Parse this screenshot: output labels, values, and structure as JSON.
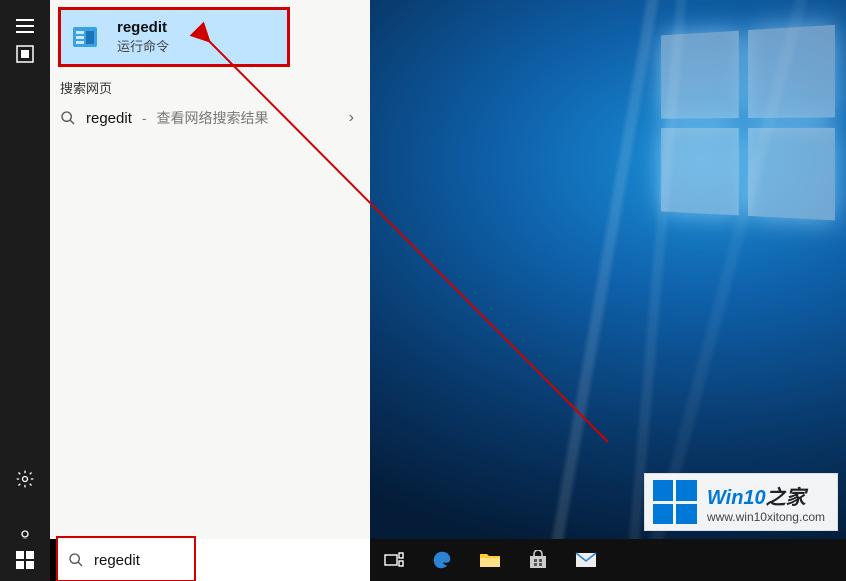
{
  "search": {
    "query": "regedit",
    "placeholder": ""
  },
  "bestMatch": {
    "title": "regedit",
    "subtitle": "运行命令",
    "iconName": "regedit-icon"
  },
  "sections": {
    "webHeader": "搜索网页"
  },
  "webResult": {
    "query": "regedit",
    "separator": " - ",
    "hint": "查看网络搜索结果",
    "chevron": "›"
  },
  "rail": {
    "settingsLabel": "settings",
    "powerLabel": "power",
    "docsLabel": "documents"
  },
  "taskbar": {
    "taskview": "task-view",
    "edge": "edge",
    "explorer": "file-explorer",
    "store": "store",
    "mail": "mail"
  },
  "watermark": {
    "brandMain": "Win10",
    "brandSuffix": "之家",
    "url": "www.win10xitong.com"
  },
  "colors": {
    "highlightBorder": "#d10000",
    "accent": "#0078d7",
    "bestMatchBg": "#bfe4ff"
  }
}
